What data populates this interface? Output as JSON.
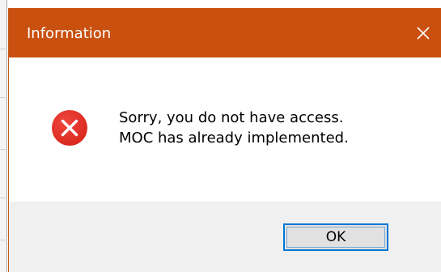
{
  "dialog": {
    "title": "Information",
    "close_icon": "close-icon",
    "icon": "error-icon",
    "message_lines": [
      "Sorry, you do not have access.",
      "MOC has already implemented."
    ],
    "ok_label": "OK"
  },
  "colors": {
    "titlebar": "#c9500f",
    "error_icon": "#e81123",
    "button_border": "#0078d7"
  }
}
